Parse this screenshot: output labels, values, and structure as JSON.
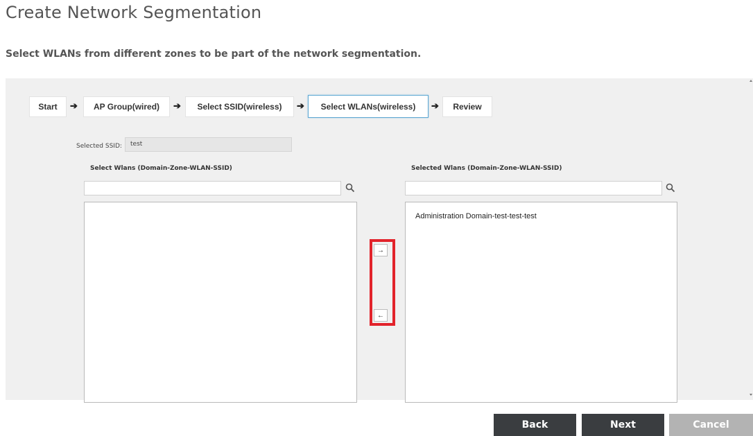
{
  "page": {
    "title": "Create Network Segmentation",
    "subtitle": "Select WLANs from different zones to be part of the network segmentation."
  },
  "wizard": {
    "steps": [
      {
        "label": "Start"
      },
      {
        "label": "AP Group(wired)"
      },
      {
        "label": "Select SSID(wireless)"
      },
      {
        "label": "Select WLANs(wireless)",
        "active": true
      },
      {
        "label": "Review"
      }
    ],
    "arrow_glyph": "➔"
  },
  "ssid": {
    "label": "Selected SSID:",
    "value": "test"
  },
  "available": {
    "label": "Select Wlans (Domain-Zone-WLAN-SSID)",
    "search_value": "",
    "items": []
  },
  "selected": {
    "label": "Selected Wlans (Domain-Zone-WLAN-SSID)",
    "search_value": "",
    "items": [
      "Administration Domain-test-test-test"
    ]
  },
  "transfer": {
    "add_glyph": "→",
    "remove_glyph": "←",
    "highlight_color": "#e2232b"
  },
  "footer": {
    "back_label": "Back",
    "next_label": "Next",
    "cancel_label": "Cancel"
  },
  "colors": {
    "panel_bg": "#f0f0f0",
    "primary_button": "#3a3d40",
    "disabled_button": "#b3b3b3",
    "active_step_border": "#5fa8d3"
  }
}
